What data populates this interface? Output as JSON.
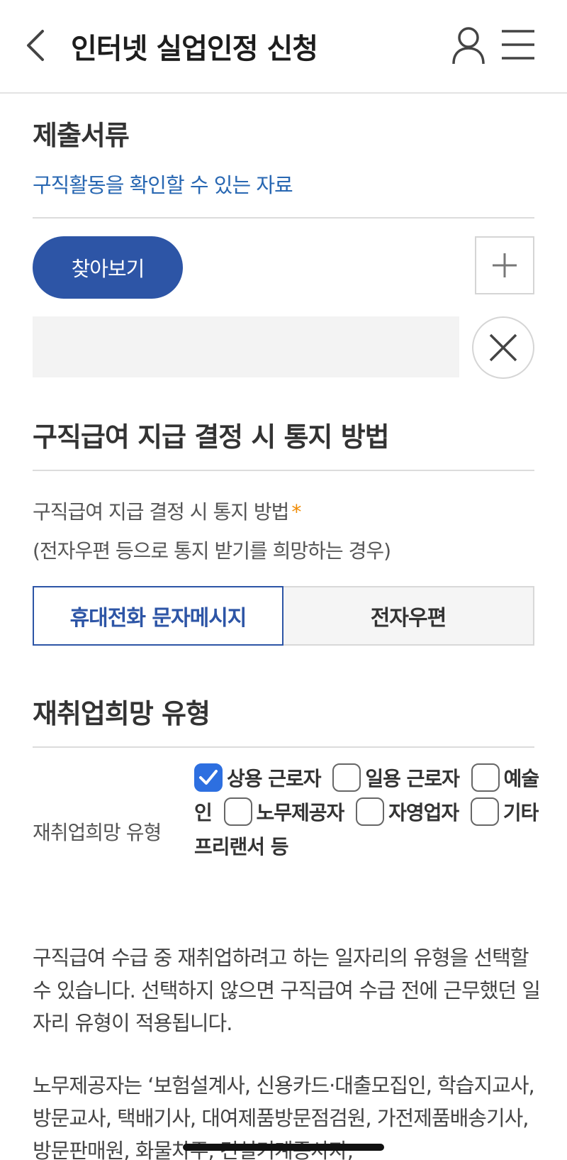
{
  "header": {
    "title": "인터넷 실업인정 신청",
    "back_icon": "chevron-left-icon",
    "user_icon": "user-icon",
    "menu_icon": "hamburger-menu-icon"
  },
  "documents": {
    "heading": "제출서류",
    "link_text": "구직활동을 확인할 수 있는 자료",
    "browse_label": "찾아보기",
    "file_value": ""
  },
  "notification": {
    "heading": "구직급여 지급 결정 시 통지 방법",
    "field_label": "구직급여 지급 결정 시 통지 방법",
    "required_mark": "*",
    "hint": "(전자우편 등으로 통지 받기를 희망하는 경우)",
    "options": [
      "휴대전화 문자메시지",
      "전자우편"
    ],
    "selected": "휴대전화 문자메시지"
  },
  "reemployment": {
    "heading": "재취업희망 유형",
    "field_label": "재취업희망 유형",
    "options": [
      {
        "label": "상용 근로자",
        "checked": true
      },
      {
        "label": "일용 근로자",
        "checked": false
      },
      {
        "label": "예술인",
        "checked": false
      },
      {
        "label": "노무제공자",
        "checked": false
      },
      {
        "label": "자영업자",
        "checked": false
      },
      {
        "label": "기타 프리랜서 등",
        "checked": false
      }
    ],
    "description": "구직급여 수급 중 재취업하려고 하는 일자리의 유형을 선택할 수 있습니다. 선택하지 않으면 구직급여 수급 전에 근무했던 일자리 유형이 적용됩니다.",
    "note": "노무제공자는 ‘보험설계사, 신용카드·대출모집인, 학습지교사, 방문교사, 택배기사, 대여제품방문점검원, 가전제품배송기사, 방문판매원, 화물차주, 건설기계종사자,"
  },
  "colors": {
    "primary": "#2d55a6",
    "link": "#2867b2",
    "required": "#f08a00",
    "checkbox_on": "#2d6fe0"
  }
}
